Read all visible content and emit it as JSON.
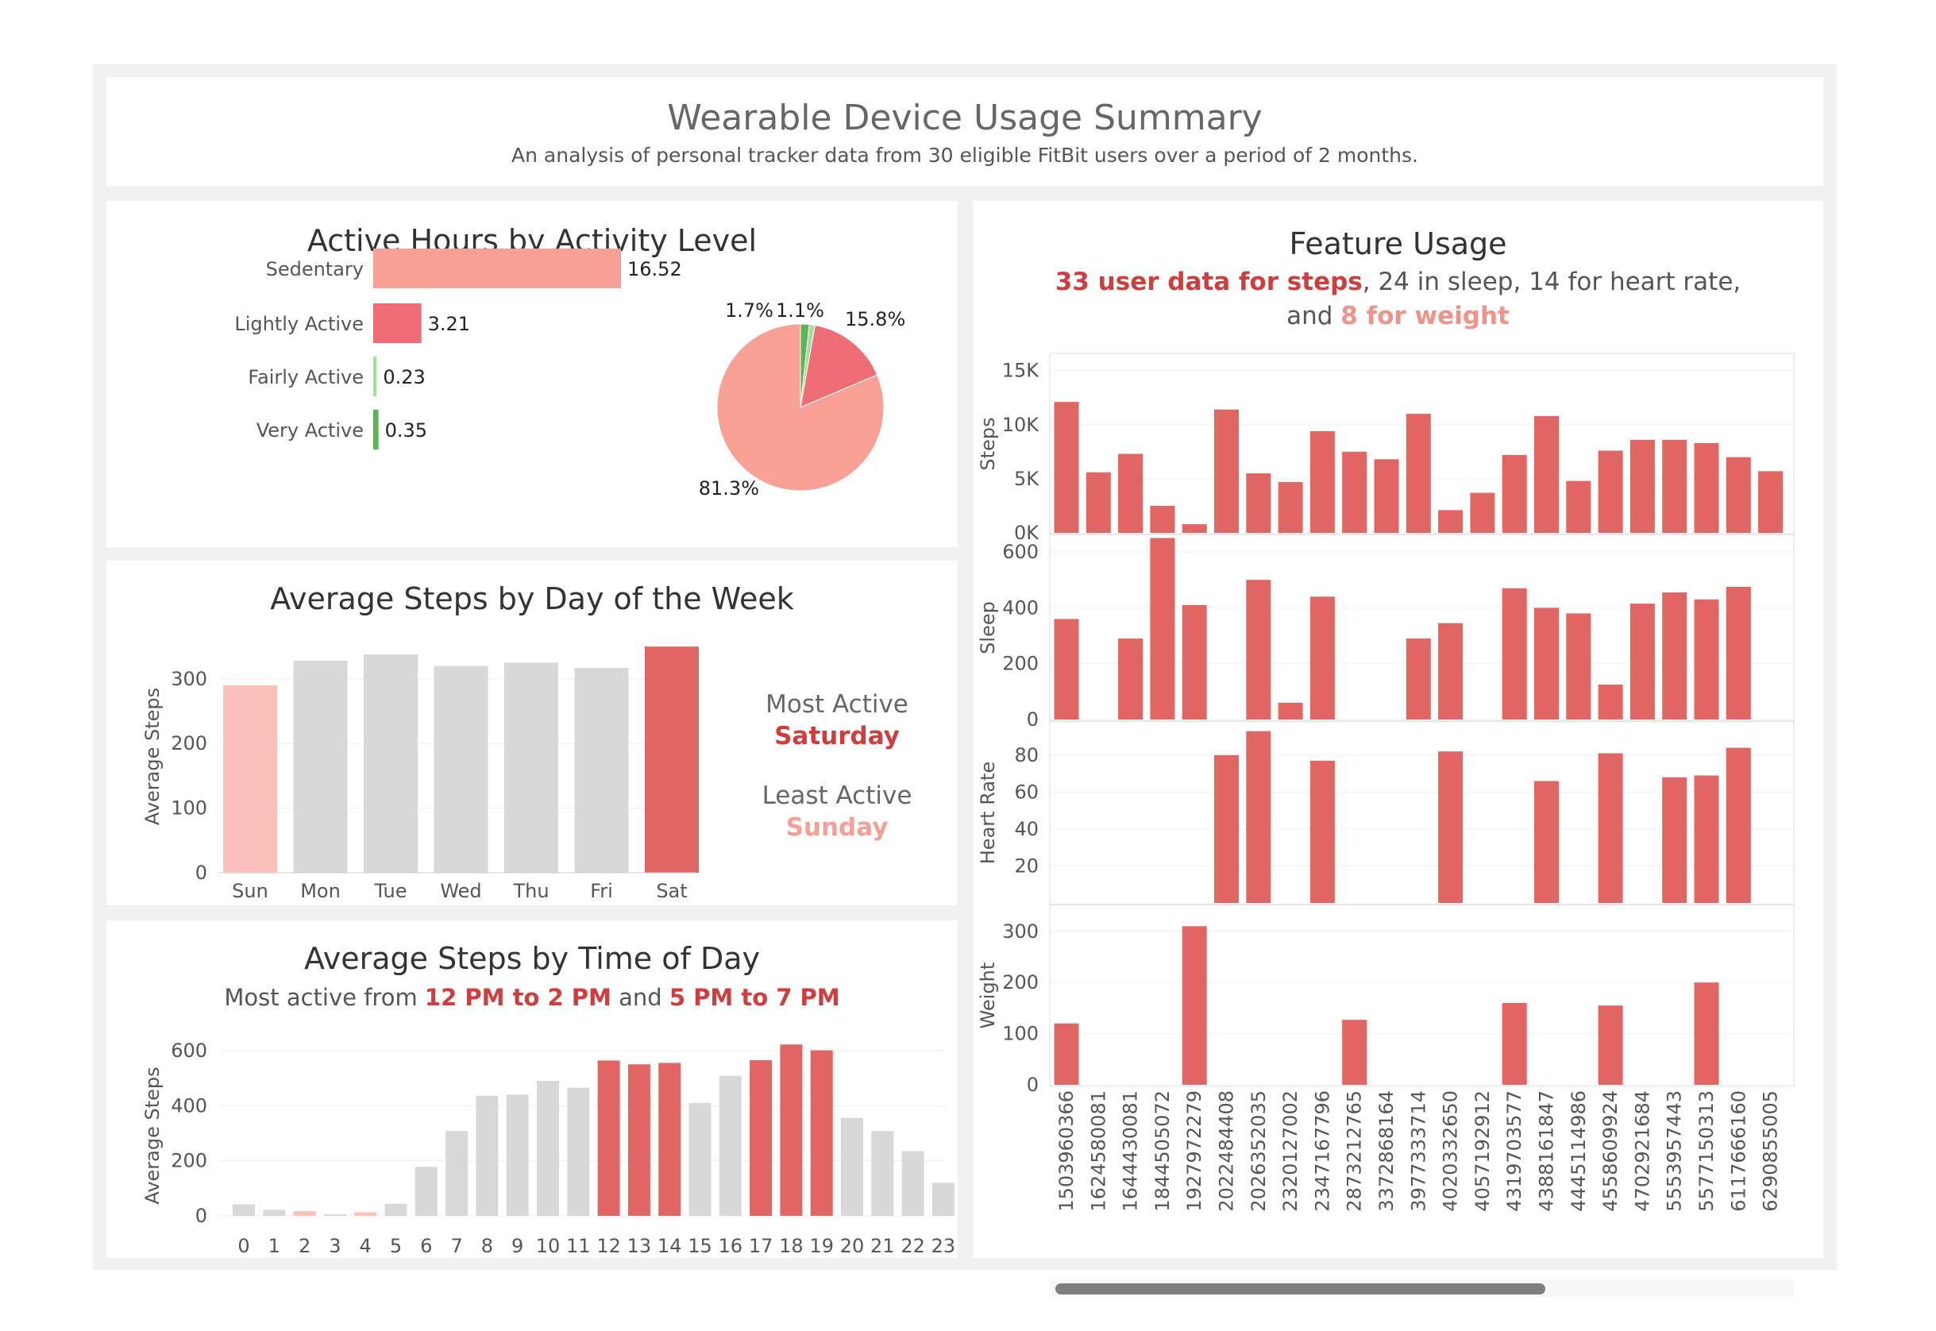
{
  "header": {
    "title": "Wearable Device Usage Summary",
    "subtitle": "An analysis of personal tracker data from 30 eligible FitBit users over a period of 2 months."
  },
  "colors": {
    "sedentary": "#f8a095",
    "lightly": "#ef6e76",
    "fairly": "#a7dba0",
    "very": "#5ab557",
    "highlight": "#e06563",
    "neutral": "#d8d8d8",
    "low": "#fcc0bb"
  },
  "active_hours": {
    "title": "Active Hours by Activity Level",
    "pie_labels": [
      "1.7%",
      "1.1%",
      "15.8%",
      "81.3%"
    ]
  },
  "dow": {
    "title": "Average Steps by Day of the Week",
    "ylabel": "Average Steps",
    "most_label": "Most Active",
    "most_value": "Saturday",
    "least_label": "Least Active",
    "least_value": "Sunday"
  },
  "tod": {
    "title": "Average Steps by Time of Day",
    "sub_a": "Most active from ",
    "sub_b": "12 PM to 2 PM",
    "sub_c": " and ",
    "sub_d": "5 PM to 7 PM",
    "ylabel": "Average Steps"
  },
  "feature": {
    "title": "Feature Usage",
    "line1_a": "33 user data for steps",
    "line1_b": ", 24 in sleep, 14 for heart rate,",
    "line2_a": "and ",
    "line2_b": "8 for weight"
  },
  "chart_data": [
    {
      "type": "bar",
      "orientation": "horizontal",
      "title": "Active Hours by Activity Level",
      "categories": [
        "Sedentary",
        "Lightly Active",
        "Fairly Active",
        "Very Active"
      ],
      "values": [
        16.52,
        3.21,
        0.23,
        0.35
      ],
      "value_labels": [
        "16.52",
        "3.21",
        "0.23",
        "0.35"
      ]
    },
    {
      "type": "pie",
      "categories": [
        "Very Active",
        "Fairly Active",
        "Lightly Active",
        "Sedentary"
      ],
      "values": [
        1.7,
        1.1,
        15.8,
        81.3
      ]
    },
    {
      "type": "bar",
      "title": "Average Steps by Day of the Week",
      "ylabel": "Average Steps",
      "categories": [
        "Sun",
        "Mon",
        "Tue",
        "Wed",
        "Thu",
        "Fri",
        "Sat"
      ],
      "values": [
        290,
        328,
        338,
        320,
        325,
        317,
        350
      ],
      "ylim": [
        0,
        360
      ],
      "yticks": [
        0,
        100,
        200,
        300
      ],
      "highlight": {
        "Sat": "max",
        "Sun": "min"
      }
    },
    {
      "type": "bar",
      "title": "Average Steps by Time of Day",
      "ylabel": "Average Steps",
      "categories": [
        "0",
        "1",
        "2",
        "3",
        "4",
        "5",
        "6",
        "7",
        "8",
        "9",
        "10",
        "11",
        "12",
        "13",
        "14",
        "15",
        "16",
        "17",
        "18",
        "19",
        "20",
        "21",
        "22",
        "23"
      ],
      "values": [
        42,
        22,
        17,
        6,
        13,
        44,
        178,
        308,
        436,
        440,
        490,
        465,
        564,
        550,
        555,
        410,
        508,
        565,
        622,
        601,
        356,
        308,
        235,
        120
      ],
      "ylim": [
        0,
        640
      ],
      "yticks": [
        0,
        200,
        400,
        600
      ],
      "highlight_hours": [
        12,
        13,
        14,
        17,
        18,
        19
      ],
      "low_hours": [
        2,
        4
      ]
    },
    {
      "type": "bar",
      "title": "Feature Usage",
      "categories": [
        "1503960366",
        "1624580081",
        "1644430081",
        "1844505072",
        "1927972279",
        "2022484408",
        "2026352035",
        "2320127002",
        "2347167796",
        "2873212765",
        "3372868164",
        "3977333714",
        "4020332650",
        "4057192912",
        "4319703577",
        "4388161847",
        "4445114986",
        "4558609924",
        "4702921684",
        "5553957443",
        "5577150313",
        "6117666160",
        "6290855005"
      ],
      "series": [
        {
          "name": "Steps",
          "ylim": [
            0,
            16000
          ],
          "yticks": [
            "0K",
            "5K",
            "10K",
            "15K"
          ],
          "tick_values": [
            0,
            5000,
            10000,
            15000
          ],
          "values": [
            12100,
            5600,
            7300,
            2500,
            800,
            11400,
            5500,
            4700,
            9400,
            7500,
            6800,
            11000,
            2100,
            3700,
            7200,
            10800,
            4800,
            7600,
            8600,
            8600,
            8300,
            7000,
            5700
          ]
        },
        {
          "name": "Sleep",
          "ylim": [
            0,
            640
          ],
          "yticks": [
            "0",
            "200",
            "400",
            "600"
          ],
          "tick_values": [
            0,
            200,
            400,
            600
          ],
          "values": [
            360,
            null,
            290,
            650,
            410,
            null,
            500,
            60,
            440,
            null,
            null,
            290,
            345,
            null,
            470,
            400,
            380,
            125,
            415,
            455,
            430,
            475,
            null
          ]
        },
        {
          "name": "Heart Rate",
          "ylim": [
            0,
            95
          ],
          "yticks": [
            "20",
            "40",
            "60",
            "80"
          ],
          "tick_values": [
            20,
            40,
            60,
            80
          ],
          "values": [
            null,
            null,
            null,
            null,
            null,
            80,
            93,
            null,
            77,
            null,
            null,
            null,
            82,
            null,
            null,
            66,
            null,
            81,
            null,
            68,
            69,
            84,
            null
          ]
        },
        {
          "name": "Weight",
          "ylim": [
            0,
            340
          ],
          "yticks": [
            "0",
            "100",
            "200",
            "300"
          ],
          "tick_values": [
            0,
            100,
            200,
            300
          ],
          "values": [
            120,
            null,
            null,
            null,
            310,
            null,
            null,
            null,
            null,
            127,
            null,
            null,
            null,
            null,
            160,
            null,
            null,
            155,
            null,
            null,
            200,
            null,
            null
          ]
        }
      ]
    }
  ]
}
